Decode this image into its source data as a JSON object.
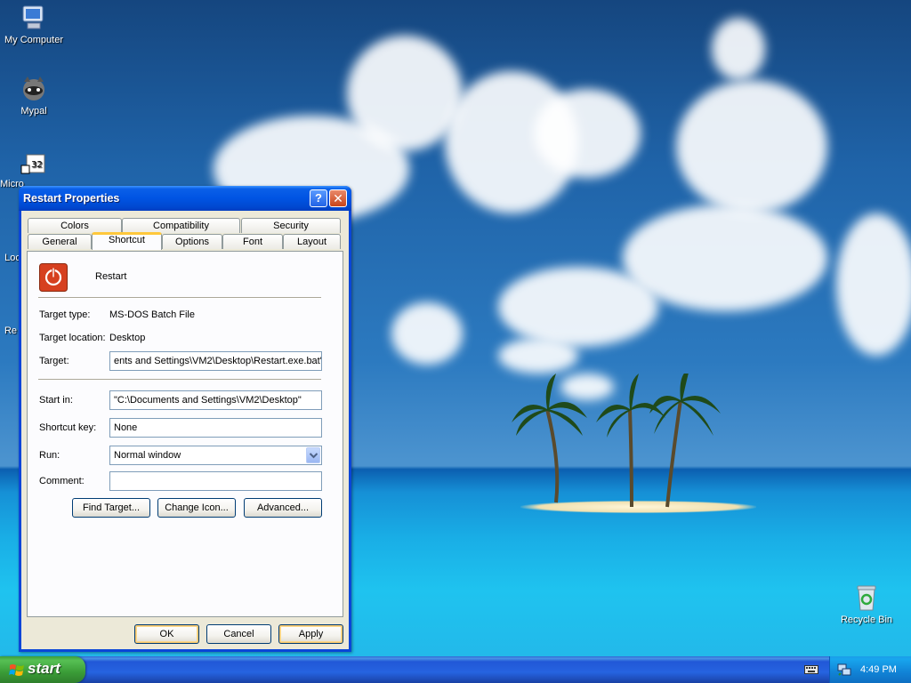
{
  "desktop": {
    "icons": [
      {
        "label": "My Computer"
      },
      {
        "label": "Mypal"
      },
      {
        "label": "Micro"
      },
      {
        "label": "Loc"
      },
      {
        "label": "Re"
      },
      {
        "label": "Recycle Bin"
      }
    ]
  },
  "window": {
    "title": "Restart Properties",
    "help_icon": "?",
    "close_icon": "✕",
    "tabs_row1": [
      "Colors",
      "Compatibility",
      "Security"
    ],
    "tabs_row2": [
      "General",
      "Shortcut",
      "Options",
      "Font",
      "Layout"
    ],
    "active_tab": "Shortcut",
    "shortcut_name": "Restart",
    "target_type_label": "Target type:",
    "target_type_value": "MS-DOS Batch File",
    "target_location_label": "Target location:",
    "target_location_value": "Desktop",
    "target_label": "Target:",
    "target_value": "ents and Settings\\VM2\\Desktop\\Restart.exe.bat\"",
    "start_in_label": "Start in:",
    "start_in_value": "\"C:\\Documents and Settings\\VM2\\Desktop\"",
    "shortcut_key_label": "Shortcut key:",
    "shortcut_key_value": "None",
    "run_label": "Run:",
    "run_value": "Normal window",
    "comment_label": "Comment:",
    "comment_value": "",
    "find_target_button": "Find Target...",
    "change_icon_button": "Change Icon...",
    "advanced_button": "Advanced...",
    "ok_button": "OK",
    "cancel_button": "Cancel",
    "apply_button": "Apply"
  },
  "taskbar": {
    "start_label": "start",
    "clock": "4:49 PM"
  },
  "colors": {
    "titlebar": "#0054e3",
    "start_button": "#3a9c37",
    "restart_icon": "#d6401f",
    "tab_highlight": "#ffc83c"
  }
}
